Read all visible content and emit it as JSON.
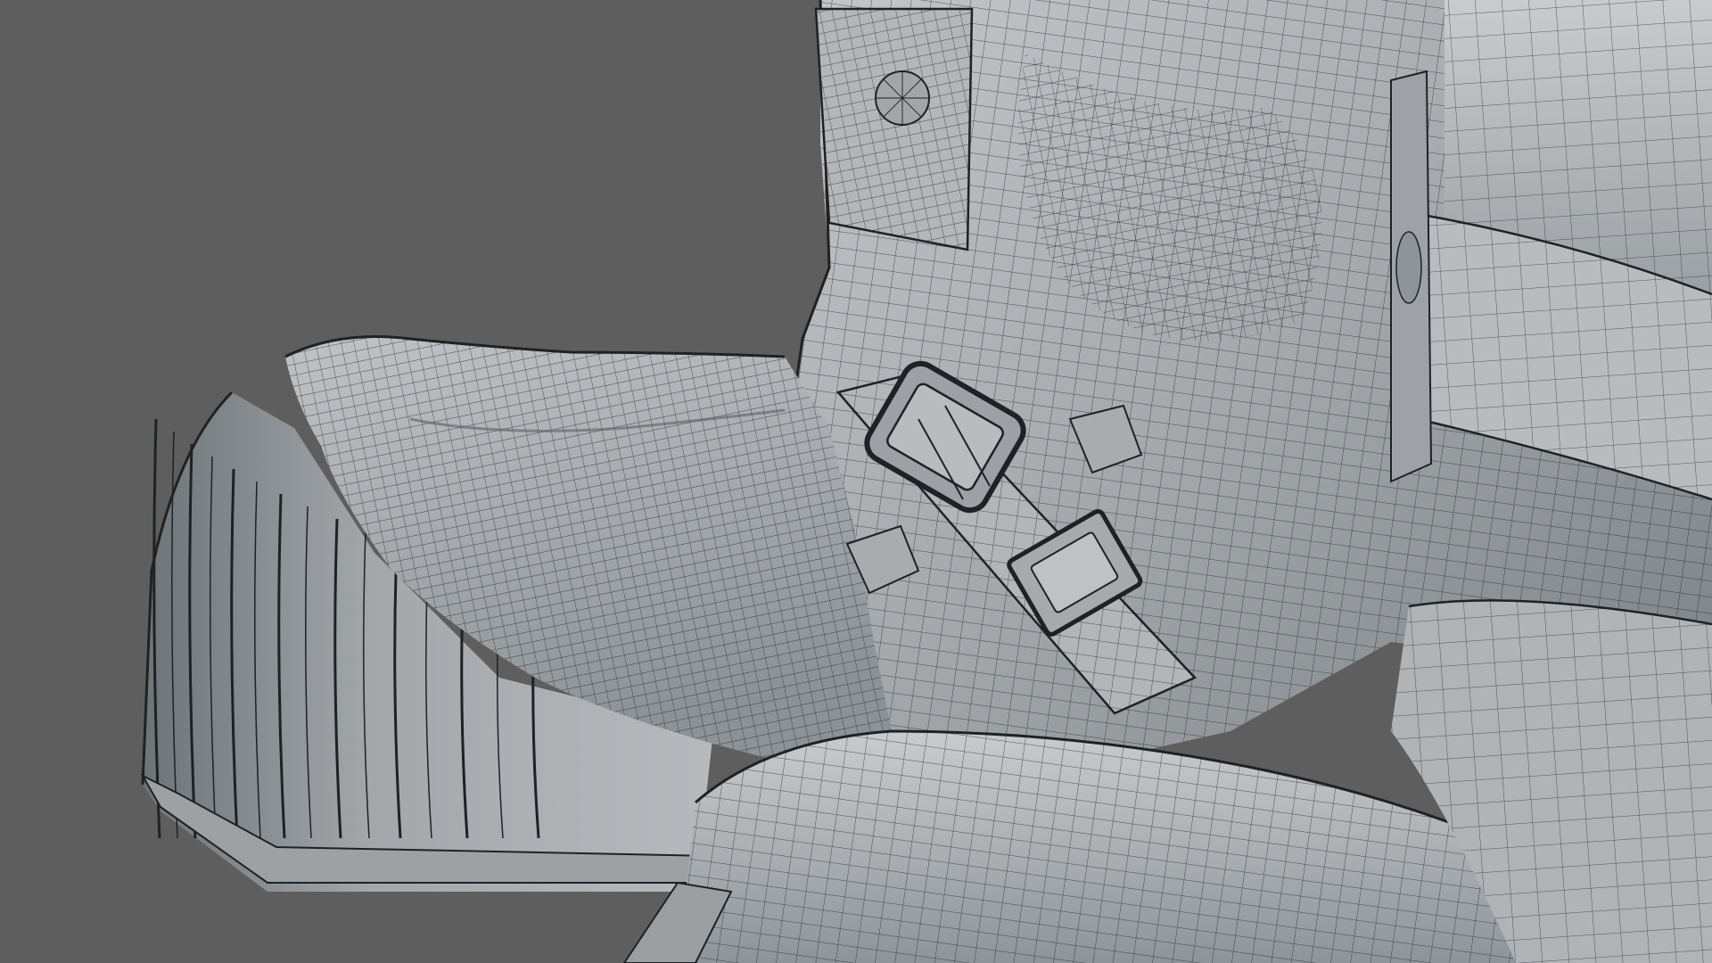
{
  "viewport": {
    "background_color": "#5e5e5e",
    "surface_color": "#a7abae",
    "surface_light": "#c3c6c9",
    "surface_shadow": "#6f7478",
    "wire_color": "#1e2225",
    "display_mode": "shaded-wireframe"
  },
  "model": {
    "parts": [
      "boot-sole",
      "cloth-fold",
      "trouser-leg",
      "strap",
      "buckle",
      "pocket-flap",
      "knee-pad"
    ]
  }
}
